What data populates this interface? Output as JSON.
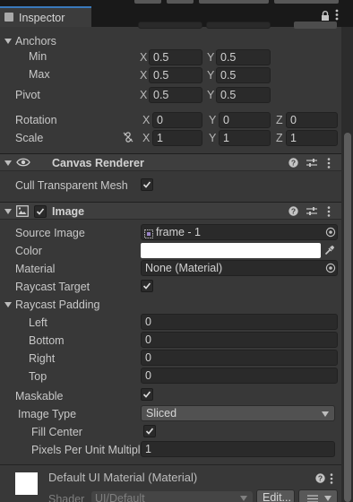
{
  "window": {
    "tab_title": "Inspector"
  },
  "rect_transform": {
    "anchors_label": "Anchors",
    "min_label": "Min",
    "max_label": "Max",
    "pivot_label": "Pivot",
    "x_axis": "X",
    "y_axis": "Y",
    "z_axis": "Z",
    "anchor_min_x": "0.5",
    "anchor_min_y": "0.5",
    "anchor_max_x": "0.5",
    "anchor_max_y": "0.5",
    "pivot_x": "0.5",
    "pivot_y": "0.5",
    "rotation_label": "Rotation",
    "rotation_x": "0",
    "rotation_y": "0",
    "rotation_z": "0",
    "scale_label": "Scale",
    "scale_x": "1",
    "scale_y": "1",
    "scale_z": "1"
  },
  "canvas_renderer": {
    "title": "Canvas Renderer",
    "cull_label": "Cull Transparent Mesh",
    "cull_checked": true
  },
  "image": {
    "title": "Image",
    "enabled": true,
    "source_image_label": "Source Image",
    "source_image_value": "frame - 1",
    "color_label": "Color",
    "color_value": "#FFFFFF",
    "material_label": "Material",
    "material_value": "None (Material)",
    "raycast_target_label": "Raycast Target",
    "raycast_target_checked": true,
    "raycast_padding_label": "Raycast Padding",
    "padding_left_label": "Left",
    "padding_left": "0",
    "padding_bottom_label": "Bottom",
    "padding_bottom": "0",
    "padding_right_label": "Right",
    "padding_right": "0",
    "padding_top_label": "Top",
    "padding_top": "0",
    "maskable_label": "Maskable",
    "maskable_checked": true,
    "image_type_label": "Image Type",
    "image_type_value": "Sliced",
    "fill_center_label": "Fill Center",
    "fill_center_checked": true,
    "ppu_label": "Pixels Per Unit Multipl",
    "ppu_value": "1"
  },
  "material_preview": {
    "title": "Default UI Material (Material)",
    "shader_label": "Shader",
    "shader_value": "UI/Default",
    "edit_label": "Edit..."
  },
  "colors": {
    "accent": "#3a79bb",
    "panel": "#383838",
    "field": "#2a2a2a"
  }
}
